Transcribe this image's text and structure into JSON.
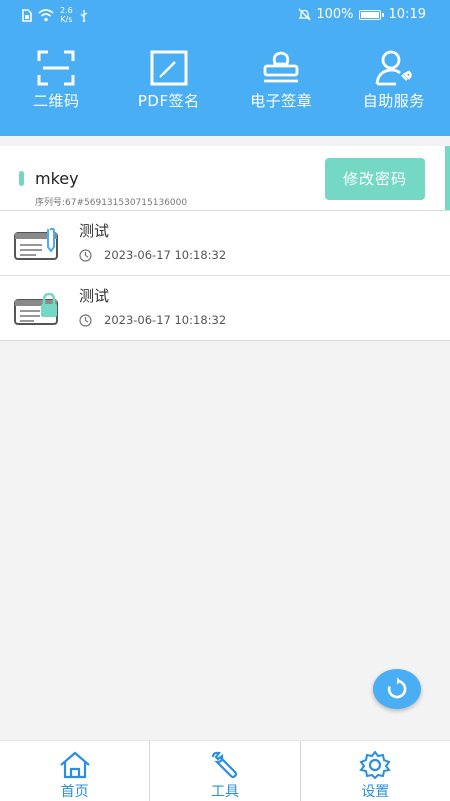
{
  "statusbar": {
    "net_speed_value": "2.6",
    "net_speed_unit": "K/s",
    "battery_percent": "100%",
    "battery_level": 1.0,
    "time": "10:19"
  },
  "quick_actions": [
    {
      "label": "二维码",
      "icon": "qr-scan-icon"
    },
    {
      "label": "PDF签名",
      "icon": "pdf-sign-icon"
    },
    {
      "label": "电子签章",
      "icon": "stamp-icon"
    },
    {
      "label": "自助服务",
      "icon": "self-service-icon"
    }
  ],
  "key_card": {
    "name": "mkey",
    "serial": "序列号:67#569131530715136000",
    "change_password_label": "修改密码"
  },
  "records": [
    {
      "title": "测试",
      "time": "2023-06-17 10:18:32",
      "icon": "signed-document-icon"
    },
    {
      "title": "测试",
      "time": "2023-06-17 10:18:32",
      "icon": "locked-document-icon"
    }
  ],
  "tabs": [
    {
      "label": "首页",
      "icon": "home-icon"
    },
    {
      "label": "工具",
      "icon": "wrench-icon"
    },
    {
      "label": "设置",
      "icon": "gear-icon"
    }
  ],
  "colors": {
    "primary": "#49aef4",
    "accent": "#74d8c4",
    "tab_text": "#2a8fde"
  }
}
